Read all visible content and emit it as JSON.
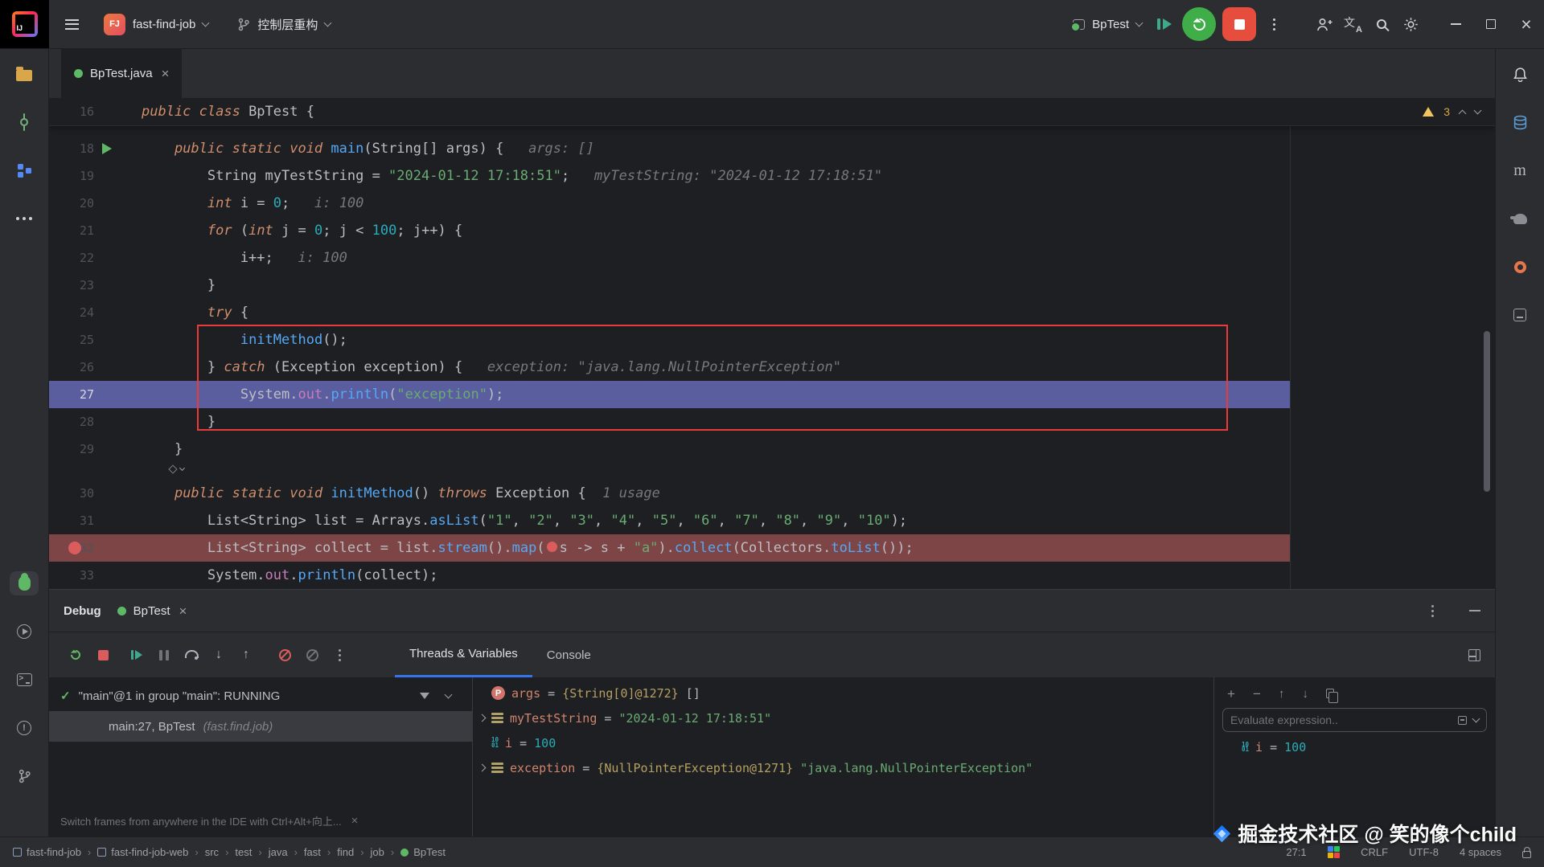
{
  "colors": {
    "accent": "#3574f0",
    "execution_line_bg": "#5a5e9e",
    "breakpoint_line_bg": "#7d4545",
    "annotation_red": "#e93b3b",
    "run_green": "#3fae49",
    "stop_red": "#e64d3d",
    "warning_yellow": "#f2c55c",
    "keyword_orange": "#cf8e6d",
    "string_green": "#6aab73",
    "number_cyan": "#2aacb8",
    "method_blue": "#56a8f5"
  },
  "title_bar": {
    "project_badge": "FJ",
    "project_name": "fast-find-job",
    "branch_name": "控制层重构",
    "run_config": "BpTest"
  },
  "editor": {
    "tab_name": "BpTest.java",
    "inspections": {
      "warning_count": "3"
    },
    "sticky_line": {
      "num": "16",
      "segments": [
        [
          "k",
          "public class "
        ],
        [
          "p",
          "BpTest {"
        ]
      ]
    },
    "lines": [
      {
        "num": "18",
        "run_icon": true,
        "segments": [
          [
            "k",
            "    public static void "
          ],
          [
            "m",
            "main"
          ],
          [
            "p",
            "(String[] args) {"
          ],
          [
            "h",
            "   args: []"
          ]
        ]
      },
      {
        "num": "19",
        "segments": [
          [
            "p",
            "        String myTestString = "
          ],
          [
            "s",
            "\"2024-01-12 17:18:51\""
          ],
          [
            "p",
            ";"
          ],
          [
            "h",
            "   myTestString: \"2024-01-12 17:18:51\""
          ]
        ]
      },
      {
        "num": "20",
        "segments": [
          [
            "k",
            "        int "
          ],
          [
            "p",
            "i = "
          ],
          [
            "n",
            "0"
          ],
          [
            "p",
            ";"
          ],
          [
            "h",
            "   i: 100"
          ]
        ]
      },
      {
        "num": "21",
        "segments": [
          [
            "k",
            "        for "
          ],
          [
            "p",
            "("
          ],
          [
            "k",
            "int "
          ],
          [
            "p",
            "j = "
          ],
          [
            "n",
            "0"
          ],
          [
            "p",
            "; j < "
          ],
          [
            "n",
            "100"
          ],
          [
            "p",
            "; j++) {"
          ]
        ]
      },
      {
        "num": "22",
        "segments": [
          [
            "p",
            "            i++;"
          ],
          [
            "h",
            "   i: 100"
          ]
        ]
      },
      {
        "num": "23",
        "segments": [
          [
            "p",
            "        }"
          ]
        ]
      },
      {
        "num": "24",
        "segments": [
          [
            "k",
            "        try "
          ],
          [
            "p",
            "{"
          ]
        ]
      },
      {
        "num": "25",
        "segments": [
          [
            "p",
            "            "
          ],
          [
            "m",
            "initMethod"
          ],
          [
            "p",
            "();"
          ]
        ]
      },
      {
        "num": "26",
        "segments": [
          [
            "p",
            "        } "
          ],
          [
            "k",
            "catch "
          ],
          [
            "p",
            "(Exception exception) {"
          ],
          [
            "h",
            "   exception: \"java.lang.NullPointerException\""
          ]
        ]
      },
      {
        "num": "27",
        "active": true,
        "highlight": "execution",
        "segments": [
          [
            "p",
            "            System."
          ],
          [
            "f",
            "out"
          ],
          [
            "p",
            "."
          ],
          [
            "m",
            "println"
          ],
          [
            "p",
            "("
          ],
          [
            "s",
            "\"exception\""
          ],
          [
            "p",
            ");"
          ]
        ]
      },
      {
        "num": "28",
        "segments": [
          [
            "p",
            "        }"
          ]
        ]
      },
      {
        "num": "29",
        "segments": [
          [
            "p",
            "    }"
          ]
        ]
      },
      {
        "inlay": true
      },
      {
        "num": "30",
        "segments": [
          [
            "k",
            "    public static void "
          ],
          [
            "m",
            "initMethod"
          ],
          [
            "p",
            "() "
          ],
          [
            "k",
            "throws "
          ],
          [
            "p",
            "Exception {"
          ],
          [
            "h",
            "  1 usage"
          ]
        ]
      },
      {
        "num": "31",
        "segments": [
          [
            "p",
            "        List<String> list = Arrays."
          ],
          [
            "m",
            "asList"
          ],
          [
            "p",
            "("
          ],
          [
            "s",
            "\"1\""
          ],
          [
            "p",
            ", "
          ],
          [
            "s",
            "\"2\""
          ],
          [
            "p",
            ", "
          ],
          [
            "s",
            "\"3\""
          ],
          [
            "p",
            ", "
          ],
          [
            "s",
            "\"4\""
          ],
          [
            "p",
            ", "
          ],
          [
            "s",
            "\"5\""
          ],
          [
            "p",
            ", "
          ],
          [
            "s",
            "\"6\""
          ],
          [
            "p",
            ", "
          ],
          [
            "s",
            "\"7\""
          ],
          [
            "p",
            ", "
          ],
          [
            "s",
            "\"8\""
          ],
          [
            "p",
            ", "
          ],
          [
            "s",
            "\"9\""
          ],
          [
            "p",
            ", "
          ],
          [
            "s",
            "\"10\""
          ],
          [
            "p",
            ");"
          ]
        ]
      },
      {
        "num": "32",
        "breakpoint": true,
        "highlight": "breakpoint",
        "segments": [
          [
            "p",
            "        List<String> collect = list."
          ],
          [
            "m",
            "stream"
          ],
          [
            "p",
            "()."
          ],
          [
            "m",
            "map"
          ],
          [
            "p",
            "("
          ],
          [
            "dot",
            ""
          ],
          [
            "p",
            "s -> s + "
          ],
          [
            "s",
            "\"a\""
          ],
          [
            "p",
            ")."
          ],
          [
            "m",
            "collect"
          ],
          [
            "p",
            "(Collectors."
          ],
          [
            "m",
            "toList"
          ],
          [
            "p",
            "());"
          ]
        ]
      },
      {
        "num": "33",
        "segments": [
          [
            "p",
            "        System."
          ],
          [
            "f",
            "out"
          ],
          [
            "p",
            "."
          ],
          [
            "m",
            "println"
          ],
          [
            "p",
            "(collect);"
          ]
        ]
      }
    ]
  },
  "debug": {
    "panel_label": "Debug",
    "session_tab": "BpTest",
    "view_tabs": [
      "Threads & Variables",
      "Console"
    ],
    "threads": {
      "thread_status": "\"main\"@1 in group \"main\": RUNNING",
      "frame_main": "main:27, BpTest ",
      "frame_package": "(fast.find.job)",
      "hint": "Switch frames from anywhere in the IDE with Ctrl+Alt+向上..."
    },
    "variables": [
      {
        "icon": "param",
        "chevron": false,
        "segments": [
          [
            "vn",
            "args"
          ],
          [
            "vp",
            " = "
          ],
          [
            "vo",
            "{String[0]@1272} "
          ],
          [
            "vp",
            "[]"
          ]
        ]
      },
      {
        "icon": "value",
        "chevron": true,
        "segments": [
          [
            "vn",
            "myTestString"
          ],
          [
            "vp",
            " = "
          ],
          [
            "s",
            "\"2024-01-12 17:18:51\""
          ]
        ]
      },
      {
        "icon": "primitive",
        "chevron": false,
        "segments": [
          [
            "vn",
            "i"
          ],
          [
            "vp",
            " = "
          ],
          [
            "n",
            "100"
          ]
        ]
      },
      {
        "icon": "value",
        "chevron": true,
        "segments": [
          [
            "vn",
            "exception"
          ],
          [
            "vp",
            " = "
          ],
          [
            "vo",
            "{NullPointerException@1271} "
          ],
          [
            "s",
            "\"java.lang.NullPointerException\""
          ]
        ]
      }
    ],
    "watches": {
      "evaluate_placeholder": "Evaluate expression..",
      "items": [
        {
          "icon": "primitive",
          "segments": [
            [
              "vn",
              "i"
            ],
            [
              "vp",
              " = "
            ],
            [
              "n",
              "100"
            ]
          ]
        }
      ]
    }
  },
  "status_bar": {
    "breadcrumbs": [
      {
        "icon": "module",
        "label": "fast-find-job"
      },
      {
        "icon": "module",
        "label": "fast-find-job-web"
      },
      {
        "icon": "",
        "label": "src"
      },
      {
        "icon": "",
        "label": "test"
      },
      {
        "icon": "",
        "label": "java"
      },
      {
        "icon": "",
        "label": "fast"
      },
      {
        "icon": "",
        "label": "find"
      },
      {
        "icon": "",
        "label": "job"
      },
      {
        "icon": "class",
        "label": "BpTest"
      }
    ],
    "caret": "27:1",
    "line_ending": "CRLF",
    "encoding": "UTF-8",
    "indent": "4 spaces"
  },
  "watermark": "掘金技术社区 @ 笑的像个child"
}
